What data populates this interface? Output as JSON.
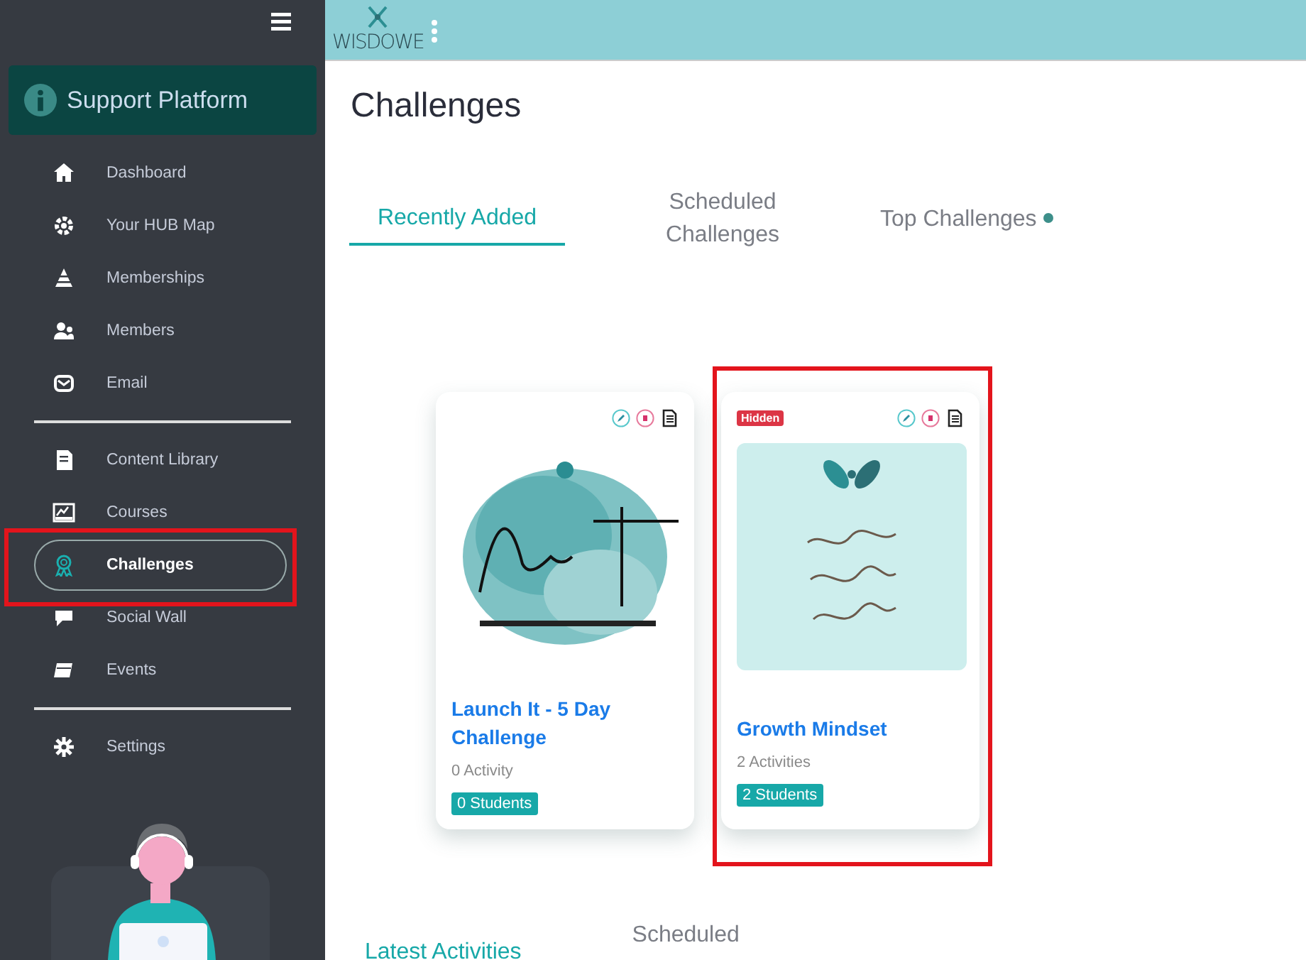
{
  "topbar": {
    "logo": "WISDOWE"
  },
  "sidebar": {
    "support": {
      "label": "Support Platform"
    },
    "nav_groups": [
      [
        {
          "label": "Dashboard",
          "selected": false,
          "highlighted": false
        },
        {
          "label": "Your HUB Map",
          "selected": false,
          "highlighted": false
        },
        {
          "label": "Memberships",
          "selected": false,
          "highlighted": false
        },
        {
          "label": "Members",
          "selected": false,
          "highlighted": false
        },
        {
          "label": "Email",
          "selected": false,
          "highlighted": false
        }
      ],
      [
        {
          "label": "Content Library",
          "selected": false,
          "highlighted": false
        },
        {
          "label": "Courses",
          "selected": false,
          "highlighted": false
        },
        {
          "label": "Challenges",
          "selected": true,
          "highlighted": true
        },
        {
          "label": "Social Wall",
          "selected": false,
          "highlighted": false
        },
        {
          "label": "Events",
          "selected": false,
          "highlighted": false
        }
      ],
      [
        {
          "label": "Settings",
          "selected": false,
          "highlighted": false
        }
      ]
    ]
  },
  "page": {
    "title": "Challenges",
    "tabs": [
      {
        "label": "Recently Added",
        "selected": true,
        "dot": false
      },
      {
        "label": "Scheduled Challenges",
        "selected": false,
        "dot": false
      },
      {
        "label": "Top Challenges",
        "selected": false,
        "dot": true
      }
    ],
    "cards": [
      {
        "title": "Launch It - 5 Day Challenge",
        "activities": "0 Activity",
        "students": "0 Students",
        "highlighted": false,
        "kind": "blob"
      },
      {
        "badge": "Hidden",
        "title": "Growth Mindset",
        "activities": "2 Activities",
        "students": "2 Students",
        "highlighted": true,
        "kind": "tile"
      }
    ],
    "bottom_tabs": [
      {
        "label": "Latest Activities",
        "selected": true
      },
      {
        "label": "Scheduled",
        "selected": false
      }
    ]
  }
}
